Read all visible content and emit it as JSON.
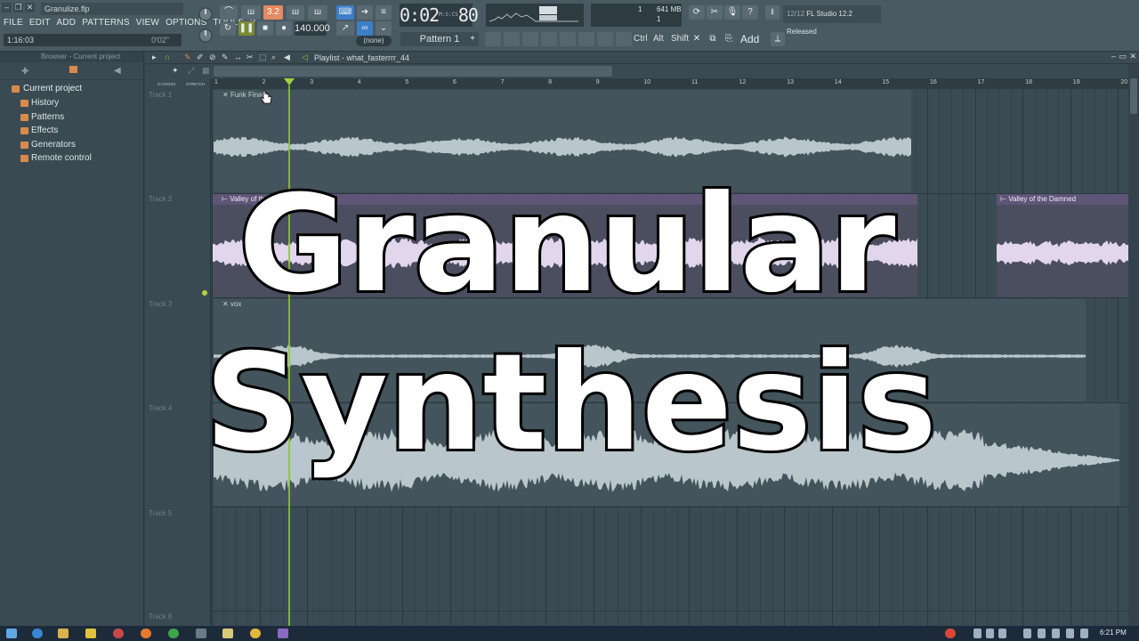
{
  "app": {
    "filename": "Granulize.flp",
    "menu": [
      "FILE",
      "EDIT",
      "ADD",
      "PATTERNS",
      "VIEW",
      "OPTIONS",
      "TOOLS",
      "?"
    ],
    "hint_time": "1:16:03",
    "hint_right": "0'02\""
  },
  "transport": {
    "pattern_number": "3.2",
    "tempo": "140.000",
    "time_main": "0:02",
    "time_sub": "80",
    "time_unit": "M:S:CS",
    "cpu_value": "1",
    "memory": "641 MB",
    "poly": "1",
    "news_count": "12/12",
    "news_text": "FL Studio 12.2 Released",
    "pattern_selector": "Pattern 1",
    "none_selector": "(none)",
    "keys": [
      "Ctrl",
      "Alt",
      "Shift"
    ],
    "add_label": "Add"
  },
  "browser": {
    "header": "Browser - Current project",
    "root": "Current project",
    "items": [
      "History",
      "Patterns",
      "Effects",
      "Generators",
      "Remote control"
    ]
  },
  "playlist": {
    "title": "Playlist - what_fasterrrr_44",
    "zcross": "Z-CROSS",
    "stretch": "STRETCH",
    "ruler": [
      "1",
      "2",
      "3",
      "4",
      "5",
      "6",
      "7",
      "8",
      "9",
      "10",
      "11",
      "12",
      "13",
      "14",
      "15",
      "16",
      "17",
      "18",
      "19",
      "20"
    ],
    "tracks": [
      "Track 1",
      "Track 2",
      "Track 3",
      "Track 4",
      "Track 5",
      "Track 6"
    ],
    "clips": {
      "funk": "Funk Final",
      "valley1": "Valley of th",
      "valley2": "Valley of the Damned",
      "vox": "vox"
    }
  },
  "overlay": {
    "line1": "Granular",
    "line2": "Synthesis"
  },
  "taskbar": {
    "clock": "6:21 PM"
  },
  "colors": {
    "accent_orange": "#e38a62",
    "playhead": "#8cc43a",
    "clip_purple": "#5e5577",
    "waveform": "#b9c6cc",
    "waveform_purple": "#e2d6ec"
  }
}
